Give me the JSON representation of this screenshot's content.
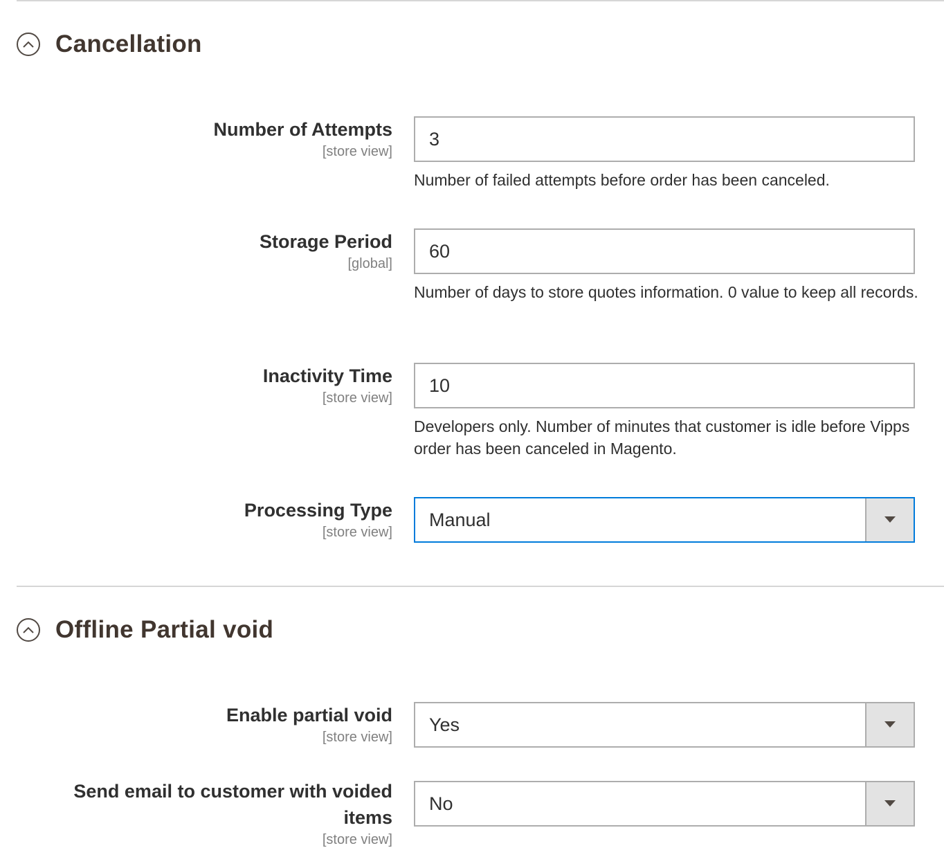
{
  "cancellation": {
    "title": "Cancellation",
    "icon": "chevron-up-circle-icon",
    "fields": {
      "attempts": {
        "label": "Number of Attempts",
        "scope": "[store view]",
        "value": "3",
        "note": "Number of failed attempts before order has been canceled."
      },
      "storage": {
        "label": "Storage Period",
        "scope": "[global]",
        "value": "60",
        "note": "Number of days to store quotes information. 0 value to keep all records."
      },
      "inactivity": {
        "label": "Inactivity Time",
        "scope": "[store view]",
        "value": "10",
        "note": "Developers only. Number of minutes that customer is idle before Vipps order has been canceled in Magento."
      },
      "processing": {
        "label": "Processing Type",
        "scope": "[store view]",
        "value": "Manual"
      }
    }
  },
  "partial_void": {
    "title": "Offline Partial void",
    "icon": "chevron-up-circle-icon",
    "fields": {
      "enable": {
        "label": "Enable partial void",
        "scope": "[store view]",
        "value": "Yes"
      },
      "email": {
        "label": "Send email to customer with voided items",
        "scope": "[store view]",
        "value": "No"
      }
    }
  },
  "colors": {
    "focus_border": "#007bdb",
    "input_border": "#adadad",
    "arrow_bg": "#e3e3e3",
    "scope_text": "#808080"
  }
}
